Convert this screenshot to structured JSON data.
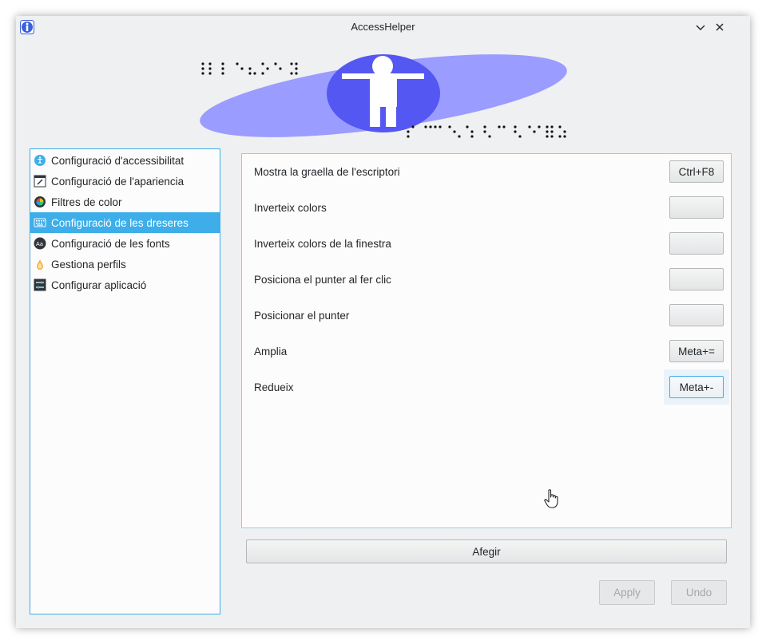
{
  "window": {
    "title": "AccessHelper"
  },
  "sidebar": {
    "items": [
      {
        "label": "Configuració d'accessibilitat",
        "icon": "accessibility-icon"
      },
      {
        "label": "Configuració de l'apariencia",
        "icon": "appearance-icon"
      },
      {
        "label": "Filtres de color",
        "icon": "color-filter-icon"
      },
      {
        "label": "Configuració de les dreseres",
        "icon": "keyboard-icon",
        "selected": true
      },
      {
        "label": "Configuració de les fonts",
        "icon": "fonts-icon"
      },
      {
        "label": "Gestiona perfils",
        "icon": "profile-icon"
      },
      {
        "label": "Configurar aplicació",
        "icon": "configure-icon"
      }
    ]
  },
  "shortcuts": [
    {
      "label": "Mostra la graella de l'escriptori",
      "key": "Ctrl+F8"
    },
    {
      "label": "Inverteix colors",
      "key": ""
    },
    {
      "label": "Inverteix colors de la finestra",
      "key": ""
    },
    {
      "label": "Posiciona el punter al fer clic",
      "key": ""
    },
    {
      "label": "Posicionar el punter",
      "key": ""
    },
    {
      "label": "Amplia",
      "key": "Meta+="
    },
    {
      "label": "Redueix",
      "key": "Meta+-"
    }
  ],
  "actions": {
    "add_label": "Afegir",
    "apply_label": "Apply",
    "undo_label": "Undo"
  },
  "colors": {
    "accent": "#3daee9",
    "banner_ellipse": "#9a9cff",
    "banner_circle": "#5457f2"
  }
}
